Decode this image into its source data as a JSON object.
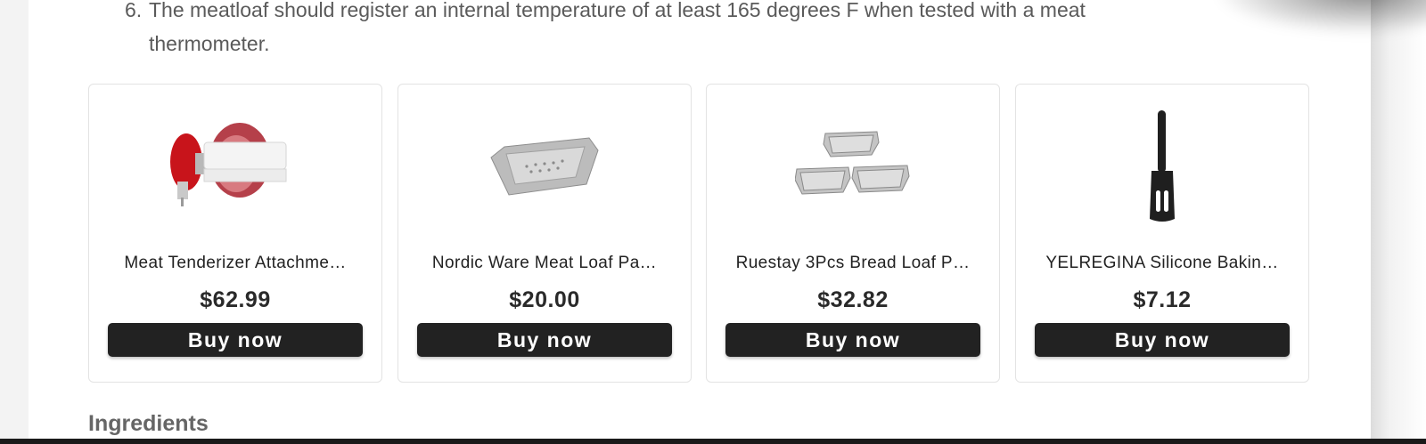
{
  "instructions": {
    "step_number": "6.",
    "step_text": "The meatloaf should register an internal temperature of at least 165 degrees F when tested with a meat thermometer."
  },
  "products": [
    {
      "title": "Meat Tenderizer Attachme…",
      "price": "$62.99",
      "button_label": "Buy now",
      "image": "meat-tenderizer-attachment"
    },
    {
      "title": "Nordic Ware Meat Loaf Pa…",
      "price": "$20.00",
      "button_label": "Buy now",
      "image": "meat-loaf-pan"
    },
    {
      "title": "Ruestay 3Pcs Bread Loaf P…",
      "price": "$32.82",
      "button_label": "Buy now",
      "image": "bread-loaf-pans"
    },
    {
      "title": "YELREGINA Silicone Bakin…",
      "price": "$7.12",
      "button_label": "Buy now",
      "image": "silicone-spatula"
    }
  ],
  "section": {
    "heading": "Ingredients"
  },
  "colors": {
    "button_bg": "#222222",
    "text": "#5a5a5a",
    "heading": "#666666"
  }
}
